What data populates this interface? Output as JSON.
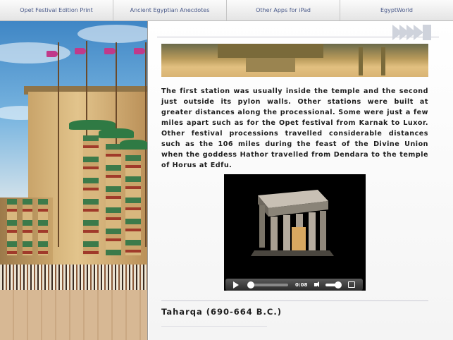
{
  "nav": {
    "tabs": [
      {
        "label": "Opet Festival Edition Print"
      },
      {
        "label": "Ancient Egyptian Anecdotes"
      },
      {
        "label": "Other Apps for iPad"
      },
      {
        "label": "EgyptWorld"
      }
    ]
  },
  "article": {
    "paragraph": "The first station was usually inside the temple and the second just outside its pylon walls. Other stations were built at greater distances along the processional. Some were just a few miles apart such as for the Opet festival from Karnak to Luxor. Other festival processions travelled considerable distances such as the 106 miles during the feast of the Divine Union when the goddess Hathor travelled from Dendara to the temple of Horus at Edfu.",
    "section_heading": "Taharqa (690-664 B.C.)"
  },
  "video": {
    "time": "0:08",
    "progress": 0.05,
    "volume": 0.9
  },
  "colors": {
    "nav_text": "#4a5a8a",
    "rule": "#c9c9d3"
  }
}
